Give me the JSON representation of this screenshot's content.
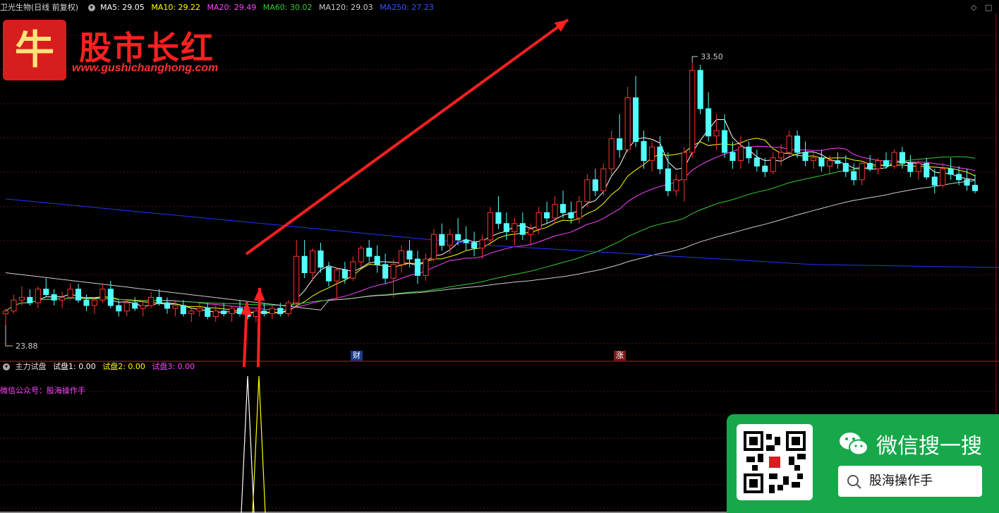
{
  "header": {
    "stock": "卫光生物(日线 前复权)",
    "ma": [
      {
        "label": "MA5: 29.05",
        "color": "#ffffff"
      },
      {
        "label": "MA10: 29.22",
        "color": "#ffff00"
      },
      {
        "label": "MA20: 29.49",
        "color": "#ff44ff"
      },
      {
        "label": "MA60: 30.02",
        "color": "#33cc33"
      },
      {
        "label": "MA120: 29.03",
        "color": "#cccccc"
      },
      {
        "label": "MA250: 27.23",
        "color": "#3333ff"
      }
    ]
  },
  "logo": {
    "char": "牛",
    "title": "股市长红",
    "url": "www.gushichanghong.com"
  },
  "price_labels": {
    "high": "33.50",
    "low": "23.88"
  },
  "event_tags": {
    "cai": "财",
    "zhang": "涨"
  },
  "indicator": {
    "name": "主力试盘",
    "lines": [
      {
        "label": "试盘1: 0.00",
        "color": "#ffffff"
      },
      {
        "label": "试盘2: 0.00",
        "color": "#ffff00"
      },
      {
        "label": "试盘3: 0.00",
        "color": "#ff44ff"
      }
    ],
    "note": "微信公众号：股海操作手"
  },
  "wechat": {
    "title": "微信搜一搜",
    "search": "股海操作手"
  },
  "colors": {
    "up": "#ff3333",
    "down": "#54ffff",
    "ma5": "#ffffff",
    "ma10": "#ffff00",
    "ma20": "#ff44ff",
    "ma60": "#33cc33",
    "ma120": "#cccccc",
    "ma250": "#2233ff",
    "arrow": "#ff2020"
  },
  "chart_data": {
    "type": "candlestick",
    "y_range": [
      23.0,
      35.0
    ],
    "candles": [
      [
        24.3,
        24.5,
        23.9,
        24.4
      ],
      [
        24.4,
        25.0,
        24.3,
        24.8
      ],
      [
        24.8,
        25.3,
        24.6,
        24.9
      ],
      [
        24.9,
        25.2,
        24.6,
        24.7
      ],
      [
        24.7,
        25.3,
        24.5,
        25.2
      ],
      [
        25.2,
        25.6,
        24.9,
        25.0
      ],
      [
        25.0,
        25.2,
        24.6,
        24.8
      ],
      [
        24.8,
        25.1,
        24.5,
        24.9
      ],
      [
        24.9,
        25.4,
        24.8,
        25.2
      ],
      [
        25.2,
        25.4,
        24.7,
        24.8
      ],
      [
        24.8,
        25.0,
        24.4,
        24.6
      ],
      [
        24.6,
        24.9,
        24.3,
        24.8
      ],
      [
        24.8,
        25.4,
        24.7,
        25.2
      ],
      [
        25.2,
        25.5,
        24.5,
        24.6
      ],
      [
        24.6,
        24.8,
        24.2,
        24.4
      ],
      [
        24.4,
        24.8,
        24.2,
        24.7
      ],
      [
        24.7,
        24.9,
        24.4,
        24.5
      ],
      [
        24.5,
        24.8,
        24.2,
        24.6
      ],
      [
        24.6,
        25.1,
        24.5,
        24.9
      ],
      [
        24.9,
        25.2,
        24.6,
        24.7
      ],
      [
        24.7,
        24.9,
        24.3,
        24.5
      ],
      [
        24.5,
        24.8,
        24.2,
        24.6
      ],
      [
        24.6,
        24.8,
        24.2,
        24.3
      ],
      [
        24.3,
        24.6,
        24.0,
        24.4
      ],
      [
        24.4,
        24.7,
        24.2,
        24.5
      ],
      [
        24.5,
        24.7,
        24.1,
        24.2
      ],
      [
        24.2,
        24.6,
        24.0,
        24.4
      ],
      [
        24.4,
        24.7,
        24.2,
        24.3
      ],
      [
        24.3,
        24.6,
        24.0,
        24.5
      ],
      [
        24.5,
        24.8,
        24.2,
        24.3
      ],
      [
        24.3,
        24.6,
        24.1,
        24.2
      ],
      [
        24.2,
        24.5,
        24.0,
        24.4
      ],
      [
        24.4,
        24.7,
        24.2,
        24.3
      ],
      [
        24.3,
        24.6,
        24.1,
        24.5
      ],
      [
        24.5,
        24.7,
        24.2,
        24.3
      ],
      [
        24.3,
        24.8,
        24.2,
        24.7
      ],
      [
        24.7,
        27.0,
        24.6,
        26.4
      ],
      [
        26.4,
        27.0,
        25.6,
        25.8
      ],
      [
        25.8,
        26.7,
        25.5,
        26.6
      ],
      [
        26.6,
        26.9,
        25.8,
        26.0
      ],
      [
        26.0,
        26.2,
        25.3,
        25.5
      ],
      [
        25.5,
        26.0,
        24.8,
        25.9
      ],
      [
        25.9,
        26.2,
        25.4,
        25.6
      ],
      [
        25.6,
        26.4,
        25.5,
        26.2
      ],
      [
        26.2,
        26.8,
        26.0,
        26.7
      ],
      [
        26.7,
        27.0,
        26.2,
        26.4
      ],
      [
        26.4,
        26.8,
        25.8,
        26.1
      ],
      [
        26.1,
        26.5,
        25.4,
        25.6
      ],
      [
        25.6,
        26.3,
        24.9,
        26.1
      ],
      [
        26.1,
        26.8,
        25.8,
        26.6
      ],
      [
        26.6,
        27.0,
        26.0,
        26.3
      ],
      [
        26.3,
        26.6,
        25.4,
        25.7
      ],
      [
        25.7,
        26.5,
        25.5,
        26.3
      ],
      [
        26.3,
        27.4,
        26.2,
        27.2
      ],
      [
        27.2,
        27.6,
        26.6,
        26.8
      ],
      [
        26.8,
        27.4,
        26.5,
        27.2
      ],
      [
        27.2,
        27.8,
        26.8,
        27.0
      ],
      [
        27.0,
        27.5,
        26.6,
        26.9
      ],
      [
        26.9,
        27.3,
        26.4,
        26.7
      ],
      [
        26.7,
        27.2,
        26.3,
        27.0
      ],
      [
        27.0,
        28.2,
        26.8,
        28.0
      ],
      [
        28.0,
        28.6,
        27.4,
        27.6
      ],
      [
        27.6,
        28.0,
        27.0,
        27.3
      ],
      [
        27.3,
        27.8,
        26.8,
        27.6
      ],
      [
        27.6,
        28.0,
        27.0,
        27.2
      ],
      [
        27.2,
        27.6,
        26.8,
        27.4
      ],
      [
        27.4,
        28.2,
        27.2,
        28.0
      ],
      [
        28.0,
        28.4,
        27.6,
        27.8
      ],
      [
        27.8,
        28.6,
        27.6,
        28.3
      ],
      [
        28.3,
        28.8,
        27.8,
        28.0
      ],
      [
        28.0,
        28.4,
        27.6,
        27.8
      ],
      [
        27.8,
        28.6,
        27.6,
        28.4
      ],
      [
        28.4,
        29.4,
        28.2,
        29.2
      ],
      [
        29.2,
        29.6,
        28.6,
        28.8
      ],
      [
        28.8,
        29.8,
        28.6,
        29.6
      ],
      [
        29.6,
        31.0,
        29.4,
        30.7
      ],
      [
        30.7,
        31.6,
        30.0,
        30.3
      ],
      [
        30.3,
        32.6,
        30.2,
        32.2
      ],
      [
        32.2,
        33.0,
        30.4,
        30.6
      ],
      [
        30.6,
        31.0,
        29.6,
        29.9
      ],
      [
        29.9,
        30.6,
        29.5,
        30.4
      ],
      [
        30.4,
        30.8,
        29.4,
        29.6
      ],
      [
        29.6,
        30.2,
        28.6,
        28.8
      ],
      [
        28.8,
        29.4,
        28.6,
        29.2
      ],
      [
        29.2,
        30.4,
        28.4,
        30.2
      ],
      [
        30.2,
        33.5,
        30.0,
        33.2
      ],
      [
        33.2,
        33.4,
        31.6,
        31.8
      ],
      [
        31.8,
        32.4,
        30.6,
        30.8
      ],
      [
        30.8,
        31.6,
        30.3,
        31.0
      ],
      [
        31.0,
        31.6,
        30.0,
        30.2
      ],
      [
        30.2,
        30.6,
        29.6,
        29.9
      ],
      [
        29.9,
        30.8,
        29.6,
        30.4
      ],
      [
        30.4,
        30.6,
        29.8,
        30.0
      ],
      [
        30.0,
        30.3,
        29.5,
        29.7
      ],
      [
        29.7,
        30.0,
        29.3,
        29.5
      ],
      [
        29.5,
        30.2,
        29.4,
        30.0
      ],
      [
        30.0,
        30.5,
        29.7,
        30.2
      ],
      [
        30.2,
        31.0,
        30.0,
        30.8
      ],
      [
        30.8,
        31.0,
        30.0,
        30.2
      ],
      [
        30.2,
        30.6,
        29.7,
        29.9
      ],
      [
        29.9,
        30.2,
        29.6,
        30.0
      ],
      [
        30.0,
        30.3,
        29.5,
        29.7
      ],
      [
        29.7,
        30.1,
        29.4,
        29.9
      ],
      [
        29.9,
        30.2,
        29.6,
        29.8
      ],
      [
        29.8,
        30.1,
        29.3,
        29.5
      ],
      [
        29.5,
        29.8,
        29.0,
        29.2
      ],
      [
        29.2,
        29.9,
        29.0,
        29.8
      ],
      [
        29.8,
        30.1,
        29.5,
        29.6
      ],
      [
        29.6,
        30.0,
        29.4,
        29.9
      ],
      [
        29.9,
        30.2,
        29.6,
        29.7
      ],
      [
        29.7,
        30.3,
        29.6,
        30.2
      ],
      [
        30.2,
        30.4,
        29.6,
        29.8
      ],
      [
        29.8,
        30.1,
        29.3,
        29.5
      ],
      [
        29.5,
        29.9,
        29.2,
        29.8
      ],
      [
        29.8,
        30.0,
        29.2,
        29.3
      ],
      [
        29.3,
        29.6,
        28.7,
        29.0
      ],
      [
        29.0,
        29.8,
        28.9,
        29.6
      ],
      [
        29.6,
        30.0,
        29.2,
        29.4
      ],
      [
        29.4,
        29.7,
        29.0,
        29.2
      ],
      [
        29.2,
        29.6,
        28.8,
        29.0
      ],
      [
        29.0,
        29.4,
        28.7,
        28.8
      ]
    ],
    "ma250": [
      [
        0,
        28.5
      ],
      [
        60,
        26.8
      ],
      [
        100,
        26.1
      ],
      [
        142,
        25.9
      ]
    ],
    "markers": {
      "high_index": 85,
      "low_index": 0
    }
  }
}
